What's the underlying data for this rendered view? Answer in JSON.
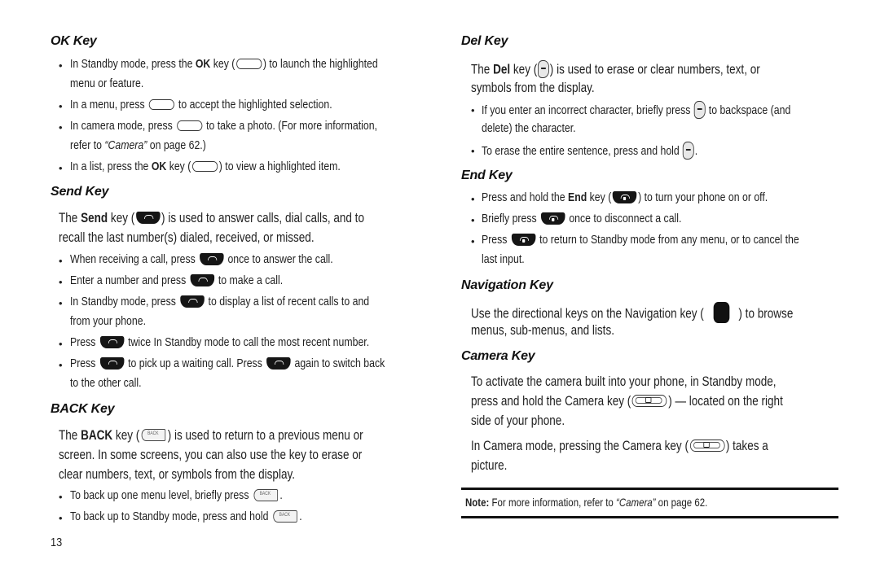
{
  "page_number": "13",
  "left": {
    "ok_key": {
      "heading": "OK Key",
      "b1": {
        "a": "In Standby mode, press the ",
        "bold": "OK",
        "b": " key (",
        "c": ") to launch the highlighted",
        "cont": "menu or feature."
      },
      "b2": {
        "a": "In a menu, press ",
        "b": " to accept the highlighted selection."
      },
      "b3": {
        "a": "In camera mode, press ",
        "b": " to take a photo. (For more information,",
        "cont_a": "refer to ",
        "cont_q": "“Camera”",
        "cont_b": " on page 62.)"
      },
      "b4": {
        "a": "In a list, press the ",
        "bold": "OK",
        "b": " key (",
        "c": ") to view a highlighted item."
      }
    },
    "send_key": {
      "heading": "Send Key",
      "p1": {
        "a": "The ",
        "bold": "Send",
        "b": " key (",
        "c": ") is used to answer calls, dial calls, and to",
        "cont": "recall the last number(s) dialed, received, or missed."
      },
      "b1": {
        "a": "When receiving a call, press ",
        "b": " once to answer the call."
      },
      "b2": {
        "a": "Enter a number and press ",
        "b": " to make a call."
      },
      "b3": {
        "a": "In Standby mode, press ",
        "b": " to display a list of recent calls to and",
        "cont": "from your phone."
      },
      "b4": {
        "a": "Press ",
        "b": " twice In Standby mode to call the most recent number."
      },
      "b5": {
        "a": "Press ",
        "b": " to pick up a waiting call. Press ",
        "c": " again to switch back",
        "cont": "to the other call."
      }
    },
    "back_key": {
      "heading": "BACK Key",
      "p1": {
        "a": "The ",
        "bold": "BACK",
        "b": " key (",
        "c": ") is used to return to a previous menu or",
        "l2": "screen. In some screens, you can also use the key to erase or",
        "l3": "clear numbers, text, or symbols from the display."
      },
      "b1": {
        "a": "To back up one menu level, briefly press ",
        "b": "."
      },
      "b2": {
        "a": "To back up to Standby mode, press and hold ",
        "b": "."
      }
    }
  },
  "right": {
    "del_key": {
      "heading": "Del Key",
      "p1": {
        "a": "The ",
        "bold": "Del",
        "b": " key (",
        "c": ") is used to erase or clear numbers, text, or",
        "cont": "symbols from the display."
      },
      "b1": {
        "a": "If you enter an incorrect character, briefly press ",
        "b": " to backspace (and",
        "cont": "delete) the character."
      },
      "b2": {
        "a": "To erase the entire sentence, press and hold ",
        "b": "."
      }
    },
    "end_key": {
      "heading": "End Key",
      "b1": {
        "a": "Press and hold the ",
        "bold": "End",
        "b": " key (",
        "c": ") to turn your phone on or off."
      },
      "b2": {
        "a": "Briefly press ",
        "b": " once to disconnect a call."
      },
      "b3": {
        "a": "Press ",
        "b": " to return to Standby mode from any menu, or to cancel the",
        "cont": "last input."
      }
    },
    "nav_key": {
      "heading": "Navigation Key",
      "p1": {
        "a": "Use the directional keys on the Navigation key (",
        "b": ") to browse",
        "cont": "menus, sub-menus, and lists."
      }
    },
    "camera_key": {
      "heading": "Camera Key",
      "p1": {
        "l1": "To activate the camera built into your phone, in Standby mode,",
        "a": "press and hold the Camera key (",
        "b": ") — located on the right",
        "l3": "side of your phone."
      },
      "p2": {
        "a": "In Camera mode, pressing the Camera key (",
        "b": ") takes a",
        "cont": "picture."
      }
    },
    "note": {
      "label": "Note:",
      "a": " For more information, refer to ",
      "q": "“Camera”",
      "b": " on page 62."
    }
  },
  "bullet_char": "•"
}
